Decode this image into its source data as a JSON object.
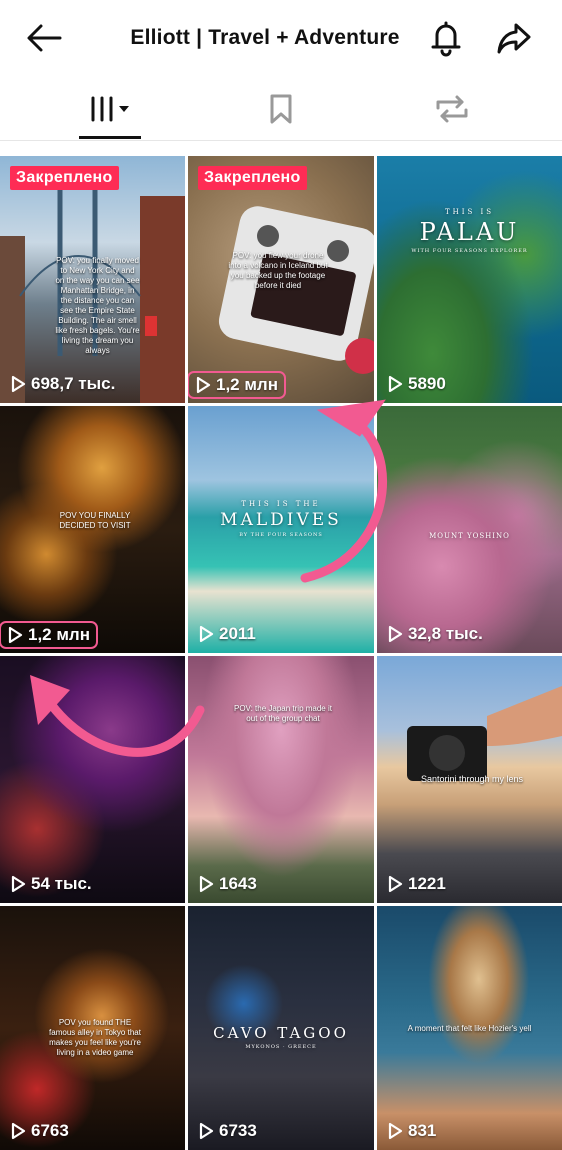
{
  "header": {
    "title": "Elliott | Travel + Adventure"
  },
  "tabs": [
    {
      "name": "videos",
      "icon": "grid-icon",
      "active": true
    },
    {
      "name": "saved",
      "icon": "bookmark-icon",
      "active": false
    },
    {
      "name": "reposts",
      "icon": "repost-icon",
      "active": false
    }
  ],
  "pinned_label": "Закреплено",
  "videos": [
    {
      "views": "698,7 тыс.",
      "pinned": true,
      "caption": "POV: you finally moved to New York City and on the way you can see Manhattan Bridge, in the distance you can see the Empire State Building. The air smell like fresh bagels. You're living the dream you always"
    },
    {
      "views": "1,2 млн",
      "pinned": true,
      "highlighted": true,
      "caption": "POV: you flew your drone into a volcano in Iceland but you backed up the footage before it died"
    },
    {
      "views": "5890",
      "title_small": "THIS IS",
      "title": "PALAU",
      "subtitle": "WITH FOUR SEASONS EXPLORER"
    },
    {
      "views": "1,2 млн",
      "highlighted": true,
      "caption": "POV YOU FINALLY DECIDED TO VISIT"
    },
    {
      "views": "2011",
      "title_small": "THIS IS THE",
      "title": "MALDIVES",
      "subtitle": "BY THE FOUR SEASONS"
    },
    {
      "views": "32,8 тыс.",
      "title": "MOUNT YOSHINO"
    },
    {
      "views": "54 тыс."
    },
    {
      "views": "1643",
      "caption": "POV: the Japan trip made it out of the group chat"
    },
    {
      "views": "1221",
      "caption": "Santorini through my lens"
    },
    {
      "views": "6763",
      "caption": "POV you found THE famous alley in Tokyo that makes you feel like you're living in a video game"
    },
    {
      "views": "6733",
      "title": "CAVO TAGOO",
      "subtitle": "MYKONOS · GREECE"
    },
    {
      "views": "831",
      "caption": "A moment that felt like Hozier's yell"
    }
  ],
  "colors": {
    "pinned_bg": "#fe2c55",
    "highlight": "#f25a91",
    "tab_underline": "#111111"
  }
}
